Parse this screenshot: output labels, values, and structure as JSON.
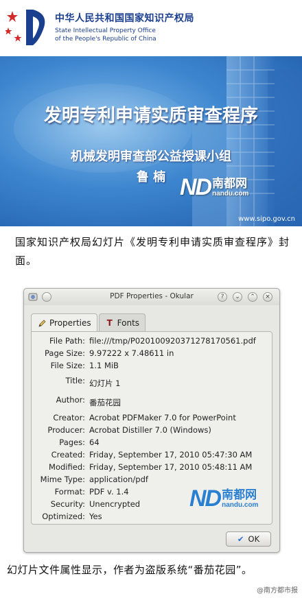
{
  "slide": {
    "org_cn": "中华人民共和国国家知识产权局",
    "org_en_line1": "State Intellectual Property Office",
    "org_en_line2": "of the People's Republic of China",
    "title": "发明专利申请实质审查程序",
    "subtitle": "机械发明审查部公益授课小组",
    "author": "鲁 楠",
    "url": "www.sipo.gov.cn"
  },
  "watermark": {
    "mark": "ND",
    "name_cn": "南都网",
    "site": "nandu.com"
  },
  "caption1": "国家知识产权局幻灯片《发明专利申请实质审查程序》封面。",
  "caption2": "幻灯片文件属性显示，作者为盗版系统“番茄花园”。",
  "weibo_credit": "@南方都市报",
  "dialog": {
    "title": "PDF Properties - Okular",
    "tabs": [
      {
        "label": "Properties",
        "icon": "pencil-icon",
        "active": true
      },
      {
        "label": "Fonts",
        "icon": "font-icon",
        "active": false
      }
    ],
    "properties": [
      {
        "key": "File Path:",
        "value": "file:///tmp/P020100920371278170561.pdf"
      },
      {
        "key": "Page Size:",
        "value": "9.97222 x 7.48611 in"
      },
      {
        "key": "File Size:",
        "value": "1.1 MiB"
      },
      {
        "key": "Title:",
        "value": "幻灯片 1"
      },
      {
        "key": "Author:",
        "value": "番茄花园"
      },
      {
        "key": "Creator:",
        "value": "Acrobat PDFMaker 7.0 for PowerPoint"
      },
      {
        "key": "Producer:",
        "value": "Acrobat Distiller 7.0 (Windows)"
      },
      {
        "key": "Pages:",
        "value": "64"
      },
      {
        "key": "Created:",
        "value": "Friday, September 17, 2010 05:47:30 AM"
      },
      {
        "key": "Modified:",
        "value": "Friday, September 17, 2010 05:48:11 AM"
      },
      {
        "key": "Mime Type:",
        "value": "application/pdf"
      },
      {
        "key": "Format:",
        "value": "PDF v. 1.4"
      },
      {
        "key": "Security:",
        "value": "Unencrypted"
      },
      {
        "key": "Optimized:",
        "value": "Yes"
      }
    ],
    "ok_label": "OK"
  },
  "colors": {
    "sipo_blue": "#1b3f8f",
    "slide_bg": "#3d86cf",
    "emblem_red": "#d22a2a",
    "nandu_blue": "#2a7fd0"
  }
}
